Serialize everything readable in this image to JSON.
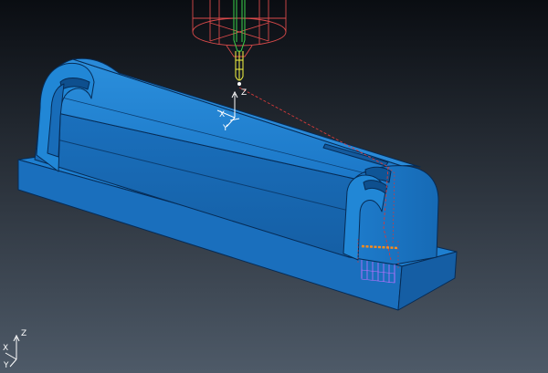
{
  "viewport": {
    "background_top": "#0a0d12",
    "background_bottom": "#4e5a68"
  },
  "colors": {
    "part_main": "#1a74c4",
    "part_light": "#2a8edc",
    "part_dark": "#0f5596",
    "part_edge": "#062b55",
    "tool_holder": "#d94a4a",
    "tool_shank": "#39d24a",
    "tool_cutter": "#e6e640",
    "toolpath_link": "#d43a3a",
    "toolpath_cut": "#ff8c1a",
    "toolpath_plunge": "#c070ff"
  },
  "icons": {
    "workplane": "workplane-triad-icon",
    "world_axis": "world-axis-triad-icon"
  },
  "workplane_axis": {
    "z": "Z",
    "x": "X",
    "y": "Y"
  },
  "world_axis": {
    "z": "Z",
    "x": "X",
    "y": "Y"
  }
}
